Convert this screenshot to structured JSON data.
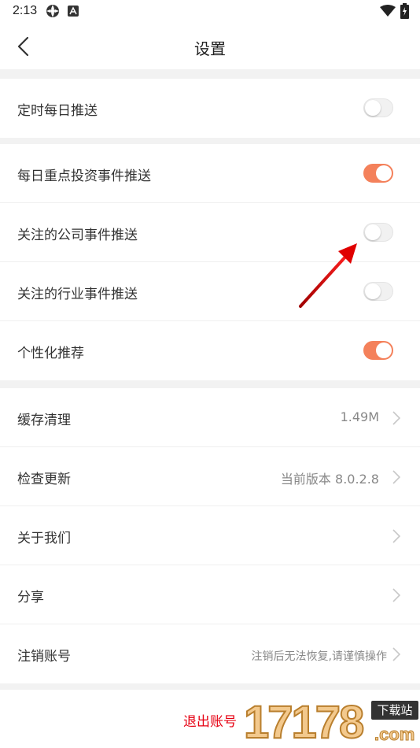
{
  "status_bar": {
    "time": "2:13"
  },
  "header": {
    "title": "设置"
  },
  "notifications_group1": {
    "daily_push": {
      "label": "定时每日推送",
      "enabled": false
    }
  },
  "notifications_group2": {
    "items": [
      {
        "label": "每日重点投资事件推送",
        "enabled": true
      },
      {
        "label": "关注的公司事件推送",
        "enabled": false
      },
      {
        "label": "关注的行业事件推送",
        "enabled": false
      },
      {
        "label": "个性化推荐",
        "enabled": true
      }
    ]
  },
  "general": {
    "items": [
      {
        "label": "缓存清理",
        "value": "1.49M"
      },
      {
        "label": "检查更新",
        "value": "当前版本 8.0.2.8"
      },
      {
        "label": "关于我们",
        "value": ""
      },
      {
        "label": "分享",
        "value": ""
      },
      {
        "label": "注销账号",
        "value": "注销后无法恢复,请谨慎操作"
      }
    ]
  },
  "footer": {
    "logout_label": "退出账号"
  },
  "watermark": {
    "digits": "17178",
    "tag": "下载站",
    "domain": ".com"
  },
  "colors": {
    "accent": "#f4815b",
    "logout_red": "#e60012",
    "annotation_arrow": "#d60000"
  }
}
